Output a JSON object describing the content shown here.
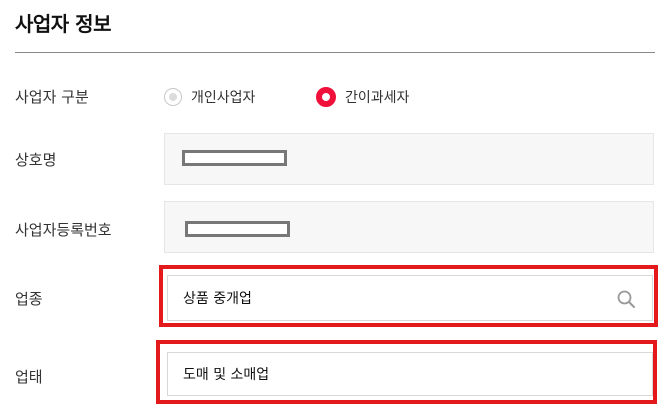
{
  "section": {
    "title": "사업자 정보"
  },
  "business_type": {
    "label": "사업자 구분",
    "options": [
      {
        "label": "개인사업자",
        "selected": false
      },
      {
        "label": "간이과세자",
        "selected": true
      }
    ]
  },
  "trade_name": {
    "label": "상호명",
    "value": ""
  },
  "registration_number": {
    "label": "사업자등록번호",
    "value": ""
  },
  "industry": {
    "label": "업종",
    "value": "상품 중개업",
    "icon": "search-icon"
  },
  "business_category": {
    "label": "업태",
    "value": "도매 및 소매업"
  },
  "colors": {
    "accent": "#f0113b",
    "highlight": "#e3191b"
  }
}
